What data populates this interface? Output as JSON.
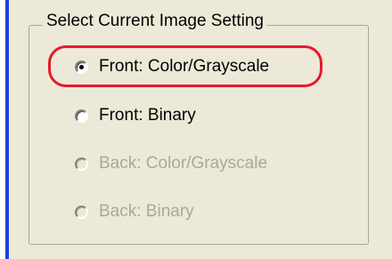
{
  "group": {
    "title": "Select Current Image Setting"
  },
  "options": [
    {
      "label": "Front: Color/Grayscale",
      "selected": true,
      "enabled": true
    },
    {
      "label": "Front: Binary",
      "selected": false,
      "enabled": true
    },
    {
      "label": "Back: Color/Grayscale",
      "selected": false,
      "enabled": false
    },
    {
      "label": "Back: Binary",
      "selected": false,
      "enabled": false
    }
  ],
  "colors": {
    "background": "#ece9d8",
    "accent_edge": "#1f3fd6",
    "highlight": "#e8192c",
    "disabled_text": "#a8a8a0"
  }
}
